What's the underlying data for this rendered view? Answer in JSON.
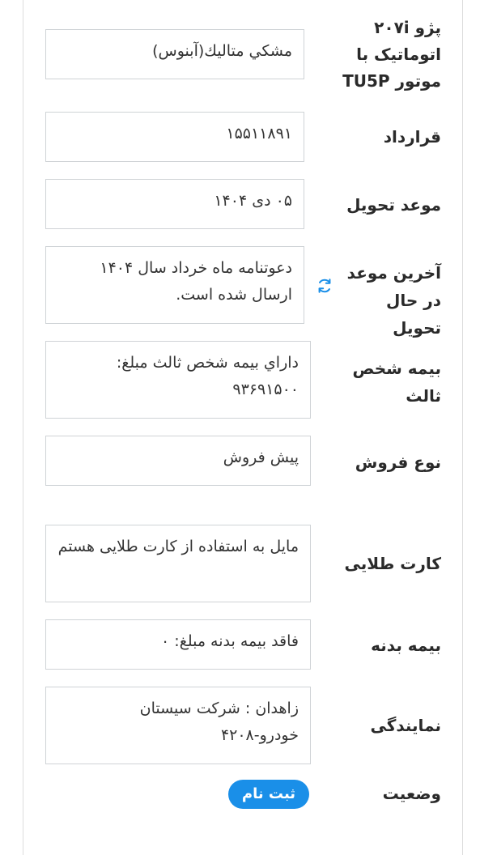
{
  "fields": [
    {
      "label": "پژو ۲۰۷i اتوماتیک با موتور TU5P",
      "value": "مشكي متاليك(آبنوس)"
    },
    {
      "label": "قرارداد",
      "value": "۱۵۵۱۱۸۹۱"
    },
    {
      "label": "موعد تحویل",
      "value": "۰۵ دی ۱۴۰۴"
    },
    {
      "label": "آخرین موعد در حال تحویل",
      "value": "دعوتنامه ماه خرداد سال ۱۴۰۴ ارسال شده است."
    },
    {
      "label": "بیمه شخص ثالث",
      "value": "داراي بيمه شخص ثالث مبلغ: ۹۳۶۹۱۵۰۰"
    },
    {
      "label": "نوع فروش",
      "value": "پیش فروش"
    },
    {
      "label": "کارت طلایی",
      "value": "مایل به استفاده از کارت طلایی هستم"
    },
    {
      "label": "بیمه بدنه",
      "value": "فاقد بیمه بدنه مبلغ: ۰"
    },
    {
      "label": "نمایندگی",
      "value": "زاهدان : شرکت سیستان خودرو-۴۲۰۸"
    }
  ],
  "status": {
    "label": "وضعیت",
    "badge": "ثبت نام"
  },
  "icons": {
    "refresh": "refresh-icon"
  },
  "colors": {
    "accent": "#1a8fe8",
    "border": "#cfd3d6"
  }
}
